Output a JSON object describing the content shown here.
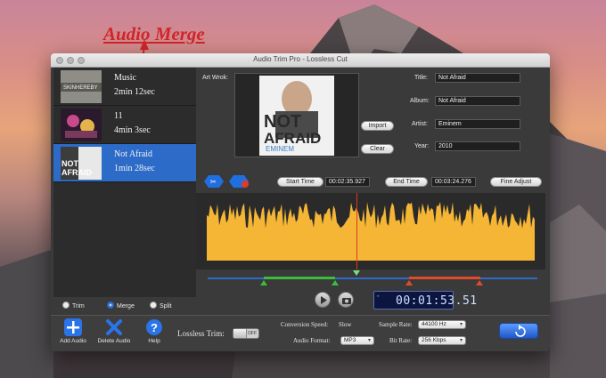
{
  "annotation": "Audio Merge",
  "window": {
    "title": "Audio Trim Pro - Lossless Cut"
  },
  "tracks": [
    {
      "name": "Music",
      "duration": "2min 12sec",
      "cover_text": "SKINHEREBY"
    },
    {
      "name": "11",
      "duration": "4min 3sec",
      "cover_text": ""
    },
    {
      "name": "Not Afraid",
      "duration": "1min 28sec",
      "cover_text": "NOT AFRAID",
      "selected": true
    }
  ],
  "modes": {
    "trim": "Trim",
    "merge": "Merge",
    "split": "Split",
    "selected": "merge"
  },
  "art": {
    "label": "Art Wrok:",
    "cover_title_1": "NOT",
    "cover_title_2": "AFRAID",
    "cover_artist": "EMINEM"
  },
  "buttons": {
    "import": "Import",
    "clear": "Clear",
    "start_time": "Start Time",
    "end_time": "End Time",
    "fine_adjust": "Fine Adjust"
  },
  "meta": {
    "title_label": "Title:",
    "title_value": "Not Afraid",
    "album_label": "Album:",
    "album_value": "Not Afraid",
    "artist_label": "Artist:",
    "artist_value": "Eminem",
    "year_label": "Year:",
    "year_value": "2010"
  },
  "times": {
    "start": "00:02:35.927",
    "end": "00:03:24.276",
    "current": "00:01:53.51"
  },
  "toolbar": {
    "add_audio": "Add Audio",
    "delete_audio": "Delete Audio",
    "help": "Help"
  },
  "settings": {
    "lossless_label": "Lossless Trim:",
    "lossless_state": "OFF",
    "speed_label": "Conversion Speed:",
    "speed_value": "Slow",
    "format_label": "Audio Format:",
    "format_value": "MP3",
    "sample_label": "Sample Rate:",
    "sample_value": "44100 Hz",
    "bitrate_label": "Bit Rate:",
    "bitrate_value": "256 Kbps"
  },
  "colors": {
    "accent": "#2d6bc9",
    "waveform": "#f5b636",
    "playhead": "#e0342a",
    "annotation": "#d1252a"
  }
}
